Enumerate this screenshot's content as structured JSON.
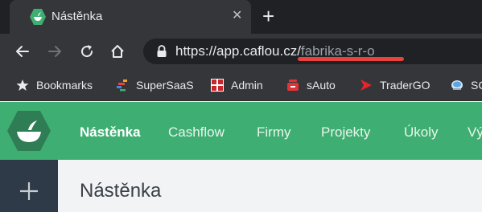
{
  "browser": {
    "tab": {
      "title": "Nástěnka",
      "close": "✕"
    },
    "new_tab": "+",
    "url": {
      "host": "https://app.caflou.cz/",
      "path": "fabrika-s-r-o"
    },
    "bookmarks": [
      {
        "label": "Bookmarks",
        "icon": "star-icon"
      },
      {
        "label": "SuperSaaS",
        "icon": "supersaas-icon"
      },
      {
        "label": "Admin",
        "icon": "admin-icon"
      },
      {
        "label": "sAuto",
        "icon": "sauto-icon"
      },
      {
        "label": "TraderGO",
        "icon": "tradergo-icon"
      },
      {
        "label": "SC",
        "icon": "sc-icon"
      }
    ]
  },
  "app": {
    "nav": [
      {
        "label": "Nástěnka",
        "active": true
      },
      {
        "label": "Cashflow"
      },
      {
        "label": "Firmy"
      },
      {
        "label": "Projekty"
      },
      {
        "label": "Úkoly"
      },
      {
        "label": "Vý"
      }
    ],
    "page_title": "Nástěnka"
  },
  "colors": {
    "brand_green": "#3fae72",
    "sidebar": "#2e3a47",
    "annotation_underline": "#e8423f"
  }
}
